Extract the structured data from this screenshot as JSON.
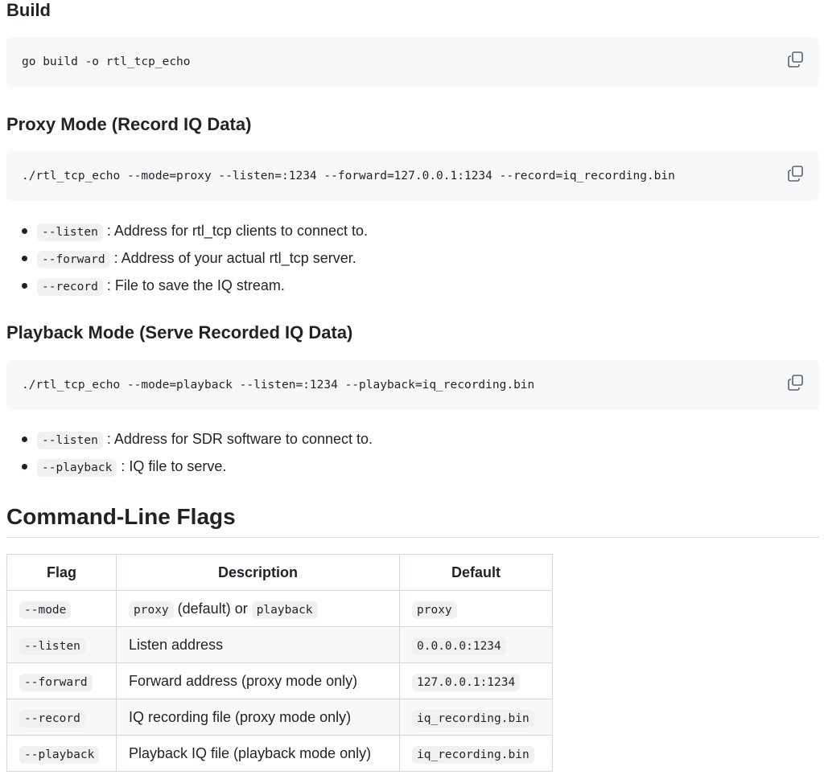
{
  "sections": {
    "build": {
      "heading": "Build",
      "code": "go build -o rtl_tcp_echo"
    },
    "proxy": {
      "heading": "Proxy Mode (Record IQ Data)",
      "code": "./rtl_tcp_echo --mode=proxy --listen=:1234 --forward=127.0.0.1:1234 --record=iq_recording.bin",
      "bullets": [
        {
          "flag": "--listen",
          "text": " : Address for rtl_tcp clients to connect to."
        },
        {
          "flag": "--forward",
          "text": " : Address of your actual rtl_tcp server."
        },
        {
          "flag": "--record",
          "text": " : File to save the IQ stream."
        }
      ]
    },
    "playback": {
      "heading": "Playback Mode (Serve Recorded IQ Data)",
      "code": "./rtl_tcp_echo --mode=playback --listen=:1234 --playback=iq_recording.bin",
      "bullets": [
        {
          "flag": "--listen",
          "text": " : Address for SDR software to connect to."
        },
        {
          "flag": "--playback",
          "text": " : IQ file to serve."
        }
      ]
    },
    "flags": {
      "heading": "Command-Line Flags",
      "table": {
        "headers": [
          "Flag",
          "Description",
          "Default"
        ],
        "rows": [
          {
            "flag": "--mode",
            "desc_code1": "proxy",
            "desc_mid": " (default) or ",
            "desc_code2": "playback",
            "default": "proxy"
          },
          {
            "flag": "--listen",
            "desc": "Listen address",
            "default": "0.0.0.0:1234"
          },
          {
            "flag": "--forward",
            "desc": "Forward address (proxy mode only)",
            "default": "127.0.0.1:1234"
          },
          {
            "flag": "--record",
            "desc": "IQ recording file (proxy mode only)",
            "default": "iq_recording.bin"
          },
          {
            "flag": "--playback",
            "desc": "Playback IQ file (playback mode only)",
            "default": "iq_recording.bin"
          }
        ]
      }
    }
  },
  "icons": {
    "copy": "copy-icon"
  }
}
